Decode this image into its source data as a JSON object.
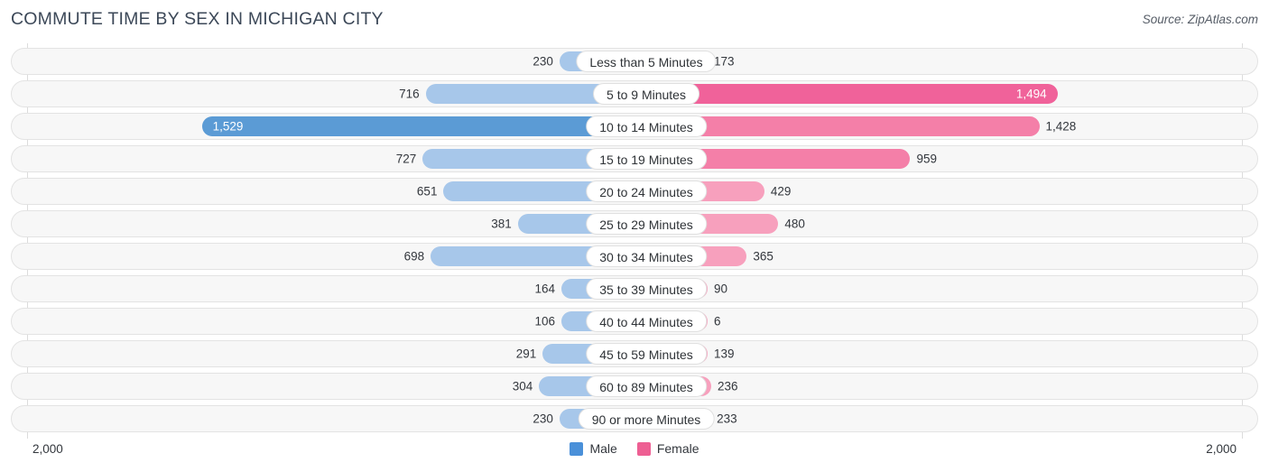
{
  "header": {
    "title": "COMMUTE TIME BY SEX IN MICHIGAN CITY",
    "source": "Source: ZipAtlas.com"
  },
  "axis": {
    "left_label": "2,000",
    "right_label": "2,000"
  },
  "legend": {
    "items": [
      {
        "label": "Male",
        "color": "#4a90d9"
      },
      {
        "label": "Female",
        "color": "#ee5f93"
      }
    ]
  },
  "chart_data": {
    "type": "bar",
    "title": "COMMUTE TIME BY SEX IN MICHIGAN CITY",
    "subtitle": "Source: ZipAtlas.com",
    "orientation": "horizontal-diverging",
    "xlabel": "",
    "ylabel": "",
    "xlim": [
      2000,
      2000
    ],
    "grid": true,
    "legend_position": "bottom-center",
    "categories": [
      "Less than 5 Minutes",
      "5 to 9 Minutes",
      "10 to 14 Minutes",
      "15 to 19 Minutes",
      "20 to 24 Minutes",
      "25 to 29 Minutes",
      "30 to 34 Minutes",
      "35 to 39 Minutes",
      "40 to 44 Minutes",
      "45 to 59 Minutes",
      "60 to 89 Minutes",
      "90 or more Minutes"
    ],
    "series": [
      {
        "name": "Male",
        "side": "left",
        "color": "#a7c7ea",
        "highlight_color": "#5b9bd5",
        "values": [
          230,
          716,
          1529,
          727,
          651,
          381,
          698,
          164,
          106,
          291,
          304,
          230
        ],
        "labels": [
          "230",
          "716",
          "1,529",
          "727",
          "651",
          "381",
          "698",
          "164",
          "106",
          "291",
          "304",
          "230"
        ]
      },
      {
        "name": "Female",
        "side": "right",
        "color": "#f7a0bd",
        "highlight_color": "#f0629a",
        "values": [
          173,
          1494,
          1428,
          959,
          429,
          480,
          365,
          90,
          6,
          139,
          236,
          233
        ],
        "labels": [
          "173",
          "1,494",
          "1,428",
          "959",
          "429",
          "480",
          "365",
          "90",
          "6",
          "139",
          "236",
          "233"
        ]
      }
    ],
    "rows": [
      {
        "category": "Less than 5 Minutes",
        "male": 230,
        "male_label": "230",
        "female": 173,
        "female_label": "173"
      },
      {
        "category": "5 to 9 Minutes",
        "male": 716,
        "male_label": "716",
        "female": 1494,
        "female_label": "1,494"
      },
      {
        "category": "10 to 14 Minutes",
        "male": 1529,
        "male_label": "1,529",
        "female": 1428,
        "female_label": "1,428"
      },
      {
        "category": "15 to 19 Minutes",
        "male": 727,
        "male_label": "727",
        "female": 959,
        "female_label": "959"
      },
      {
        "category": "20 to 24 Minutes",
        "male": 651,
        "male_label": "651",
        "female": 429,
        "female_label": "429"
      },
      {
        "category": "25 to 29 Minutes",
        "male": 381,
        "male_label": "381",
        "female": 480,
        "female_label": "480"
      },
      {
        "category": "30 to 34 Minutes",
        "male": 698,
        "male_label": "698",
        "female": 365,
        "female_label": "365"
      },
      {
        "category": "35 to 39 Minutes",
        "male": 164,
        "male_label": "164",
        "female": 90,
        "female_label": "90"
      },
      {
        "category": "40 to 44 Minutes",
        "male": 106,
        "male_label": "106",
        "female": 6,
        "female_label": "6"
      },
      {
        "category": "45 to 59 Minutes",
        "male": 291,
        "male_label": "291",
        "female": 139,
        "female_label": "139"
      },
      {
        "category": "60 to 89 Minutes",
        "male": 304,
        "male_label": "304",
        "female": 236,
        "female_label": "236"
      },
      {
        "category": "90 or more Minutes",
        "male": 230,
        "male_label": "230",
        "female": 233,
        "female_label": "233"
      }
    ]
  }
}
